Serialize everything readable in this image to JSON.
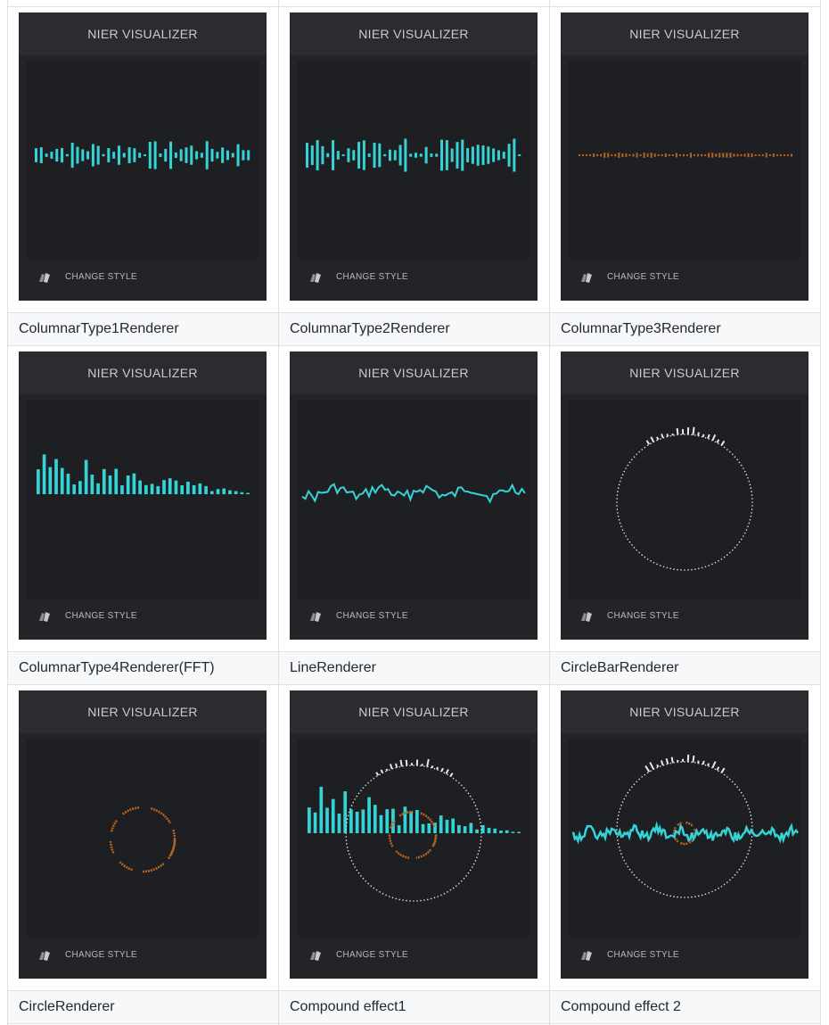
{
  "app_title": "NIER VISUALIZER",
  "change_style_label": "CHANGE STYLE",
  "icon": "style-brush-icon",
  "colors": {
    "cyan": "#35d3d6",
    "orange": "#b8651f",
    "white": "#e6e6e6",
    "bg": "#232427"
  },
  "cells": [
    {
      "caption": "ColumnarType1Renderer",
      "viz": "columnar1"
    },
    {
      "caption": "ColumnarType2Renderer",
      "viz": "columnar2"
    },
    {
      "caption": "ColumnarType3Renderer",
      "viz": "columnar3"
    },
    {
      "caption": "ColumnarType4Renderer(FFT)",
      "viz": "columnar4"
    },
    {
      "caption": "LineRenderer",
      "viz": "line"
    },
    {
      "caption": "CircleBarRenderer",
      "viz": "circlebar"
    },
    {
      "caption": "CircleRenderer",
      "viz": "circle"
    },
    {
      "caption": "Compound effect1",
      "viz": "compound1"
    },
    {
      "caption": "Compound effect 2",
      "viz": "compound2"
    }
  ]
}
